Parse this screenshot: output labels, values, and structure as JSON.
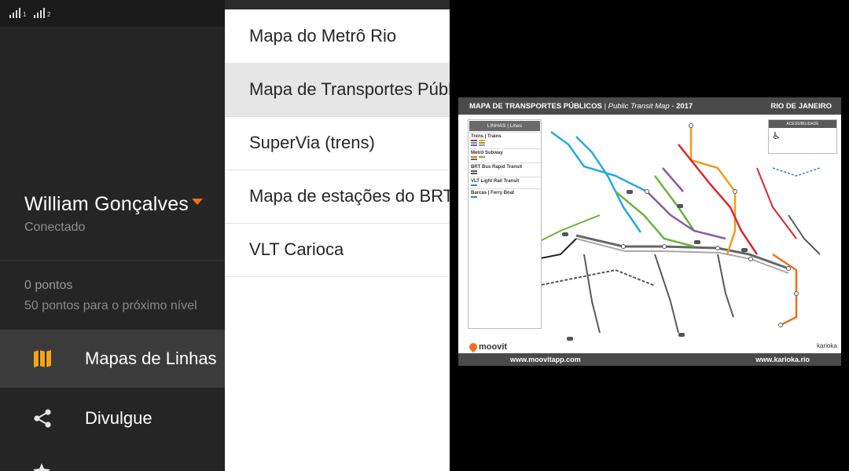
{
  "drawer": {
    "status_bar": {
      "sim1_label": "1",
      "sim2_label": "2"
    },
    "user": {
      "name": "William Gonçalves",
      "status": "Conectado"
    },
    "points": {
      "current": "0 pontos",
      "next_level": "50 pontos para o próximo nível"
    },
    "menu": [
      {
        "label": "Mapas de Linhas",
        "icon": "map-icon",
        "active": true
      },
      {
        "label": "Divulgue",
        "icon": "share-icon",
        "active": false
      }
    ],
    "accent_color": "#f0701c"
  },
  "map_list": {
    "items": [
      {
        "label": "Mapa do Metrô Rio"
      },
      {
        "label": "Mapa de Transportes Públicos",
        "selected": true
      },
      {
        "label": "SuperVia (trens)"
      },
      {
        "label": "Mapa de estações do BRT"
      },
      {
        "label": "VLT Carioca"
      }
    ]
  },
  "map_image": {
    "title": "MAPA DE TRANSPORTES PÚBLICOS",
    "subtitle": "| Public Transit Map -",
    "year": "2017",
    "city": "RIO DE JANEIRO",
    "legend_title": "LINHAS",
    "legend_title_en": "| Lines",
    "legend_sections": [
      "Trens | Trains",
      "Metrô Subway",
      "BRT Bus Rapid Transit",
      "VLT Light Rail Transit",
      "Barcas | Ferry Boat"
    ],
    "accessibility_title": "ACESSIBILIDADE",
    "brand_left": "moovit",
    "brand_right": "karioka",
    "url_left": "www.moovitapp.com",
    "url_right": "www.karioka.rio"
  }
}
